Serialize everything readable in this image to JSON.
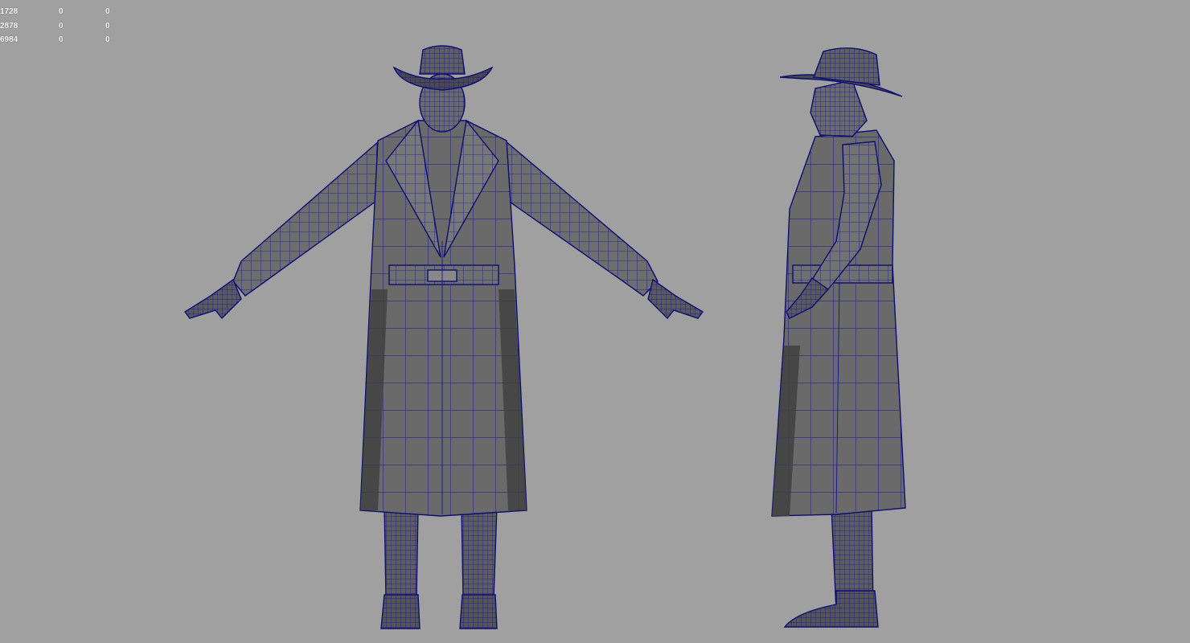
{
  "hud_stats": {
    "rows": [
      {
        "label": "1728",
        "a": "0",
        "b": "0"
      },
      {
        "label": "2878",
        "a": "0",
        "b": "0"
      },
      {
        "label": "6984",
        "a": "0",
        "b": "0"
      }
    ]
  },
  "colors": {
    "background": "#a0a0a0",
    "mesh_fill": "#6b6b6b",
    "mesh_fill_dark": "#3e3e3e",
    "wireframe": "#14148c"
  },
  "models": {
    "front_view": "character-front-view",
    "side_view": "character-side-view"
  }
}
